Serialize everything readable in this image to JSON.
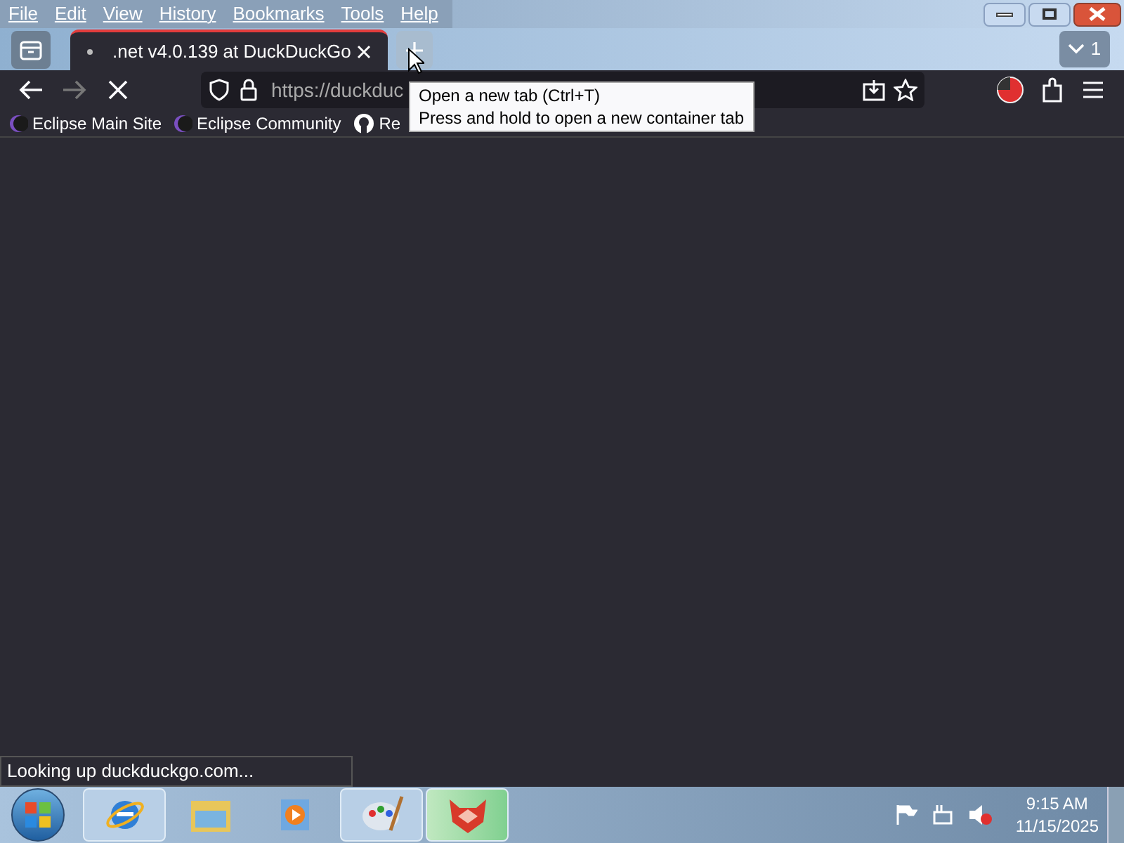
{
  "menu_bar": {
    "items": [
      "File",
      "Edit",
      "View",
      "History",
      "Bookmarks",
      "Tools",
      "Help"
    ]
  },
  "tabs": [
    {
      "title": ".net v4.0.139 at DuckDuckGo",
      "selected": true,
      "loading": true
    }
  ],
  "tab_count": "1",
  "nav": {
    "back_disabled": false,
    "forward_disabled": true,
    "url": "https://duckduc"
  },
  "tooltip": {
    "lines": [
      "Open a new tab (Ctrl+T)",
      "Press and hold to open a new container tab"
    ]
  },
  "bookmarks": [
    {
      "label": "Eclipse Main Site",
      "kind": "eclipse"
    },
    {
      "label": "Eclipse Community",
      "kind": "eclipse"
    },
    {
      "label": "Re",
      "kind": "github"
    }
  ],
  "status": "Looking up duckduckgo.com...",
  "taskbar": {
    "apps": [
      {
        "kind": "ie",
        "open": true,
        "selected": false
      },
      {
        "kind": "folder",
        "open": false,
        "selected": false
      },
      {
        "kind": "media",
        "open": false,
        "selected": false
      },
      {
        "kind": "paint",
        "open": true,
        "selected": false
      },
      {
        "kind": "browser",
        "open": true,
        "selected": true
      }
    ],
    "time": "9:15 AM",
    "date": "11/15/2025"
  }
}
